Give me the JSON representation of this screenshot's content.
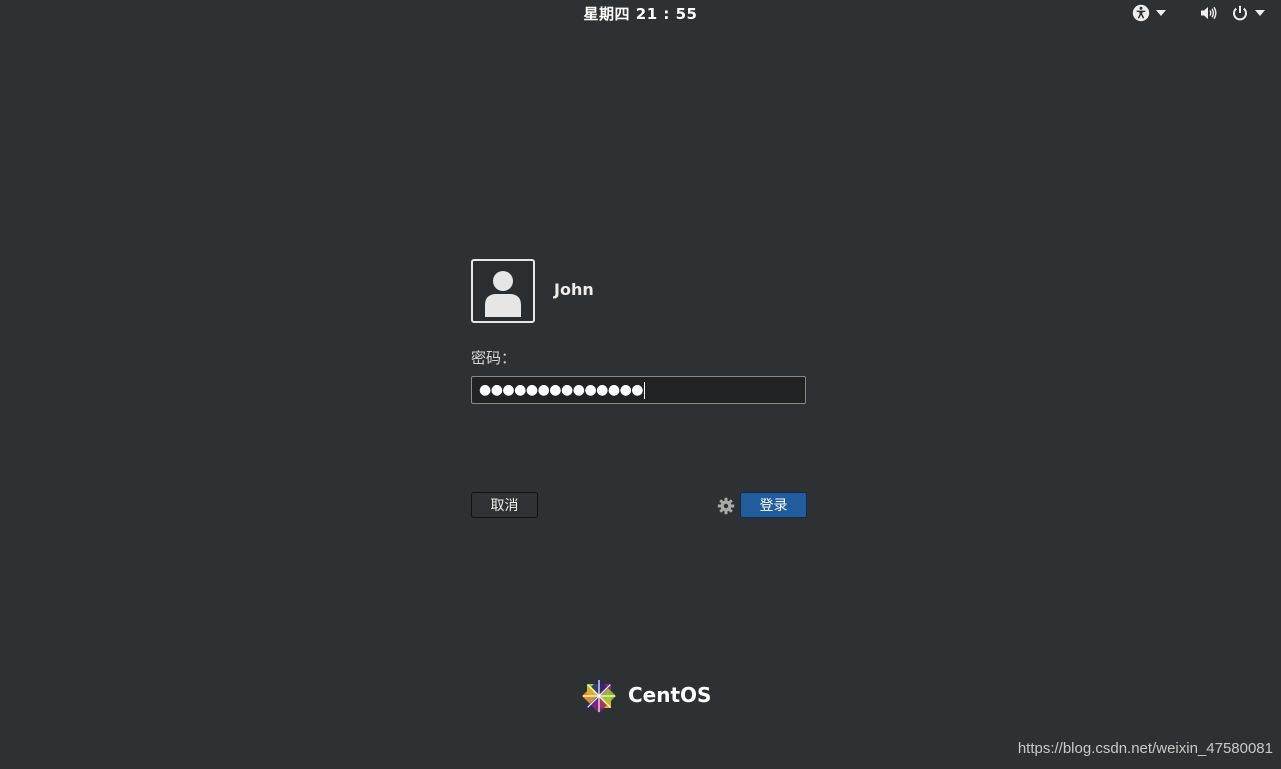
{
  "topbar": {
    "clock": "星期四 21 : 55",
    "icons": {
      "accessibility": "accessibility-icon",
      "volume": "volume-icon",
      "power": "power-icon",
      "dropdown": "chevron-down-icon"
    }
  },
  "login": {
    "username": "John",
    "password_label": "密码：",
    "password_masked": "●●●●●●●●●●●●●●",
    "cancel_label": "取消",
    "login_label": "登录",
    "settings_icon": "gear-icon",
    "avatar_icon": "user-avatar-icon"
  },
  "branding": {
    "logo_text": "CentOS"
  },
  "watermark": "https://blog.csdn.net/weixin_47580081",
  "colors": {
    "background": "#2d3133",
    "accent": "#215d9c"
  }
}
